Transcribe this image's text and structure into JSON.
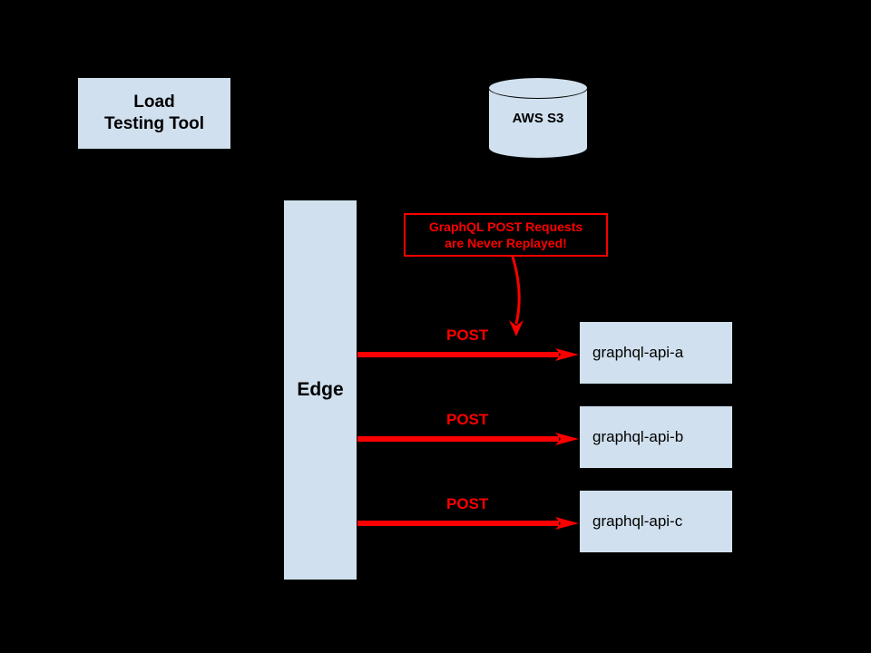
{
  "nodes": {
    "load_tool": "Load\nTesting Tool",
    "edge": "Edge",
    "s3": "AWS S3",
    "api_a": "graphql-api-a",
    "api_b": "graphql-api-b",
    "api_c": "graphql-api-c"
  },
  "callout": "GraphQL POST Requests\nare Never Replayed!",
  "arrows": {
    "post_label": "POST"
  },
  "colors": {
    "node_fill": "#d0e0ee",
    "alert": "#fc0000",
    "background": "#000000"
  },
  "diagram": {
    "description": "Architecture diagram showing a Load Testing Tool and AWS S3 at the top. An Edge component sends POST requests via three red arrows to graphql-api-a, graphql-api-b, and graphql-api-c. A red callout states GraphQL POST Requests are Never Replayed.",
    "flows": [
      {
        "from": "Edge",
        "to": "graphql-api-a",
        "label": "POST",
        "replayed": false
      },
      {
        "from": "Edge",
        "to": "graphql-api-b",
        "label": "POST",
        "replayed": false
      },
      {
        "from": "Edge",
        "to": "graphql-api-c",
        "label": "POST",
        "replayed": false
      }
    ]
  }
}
